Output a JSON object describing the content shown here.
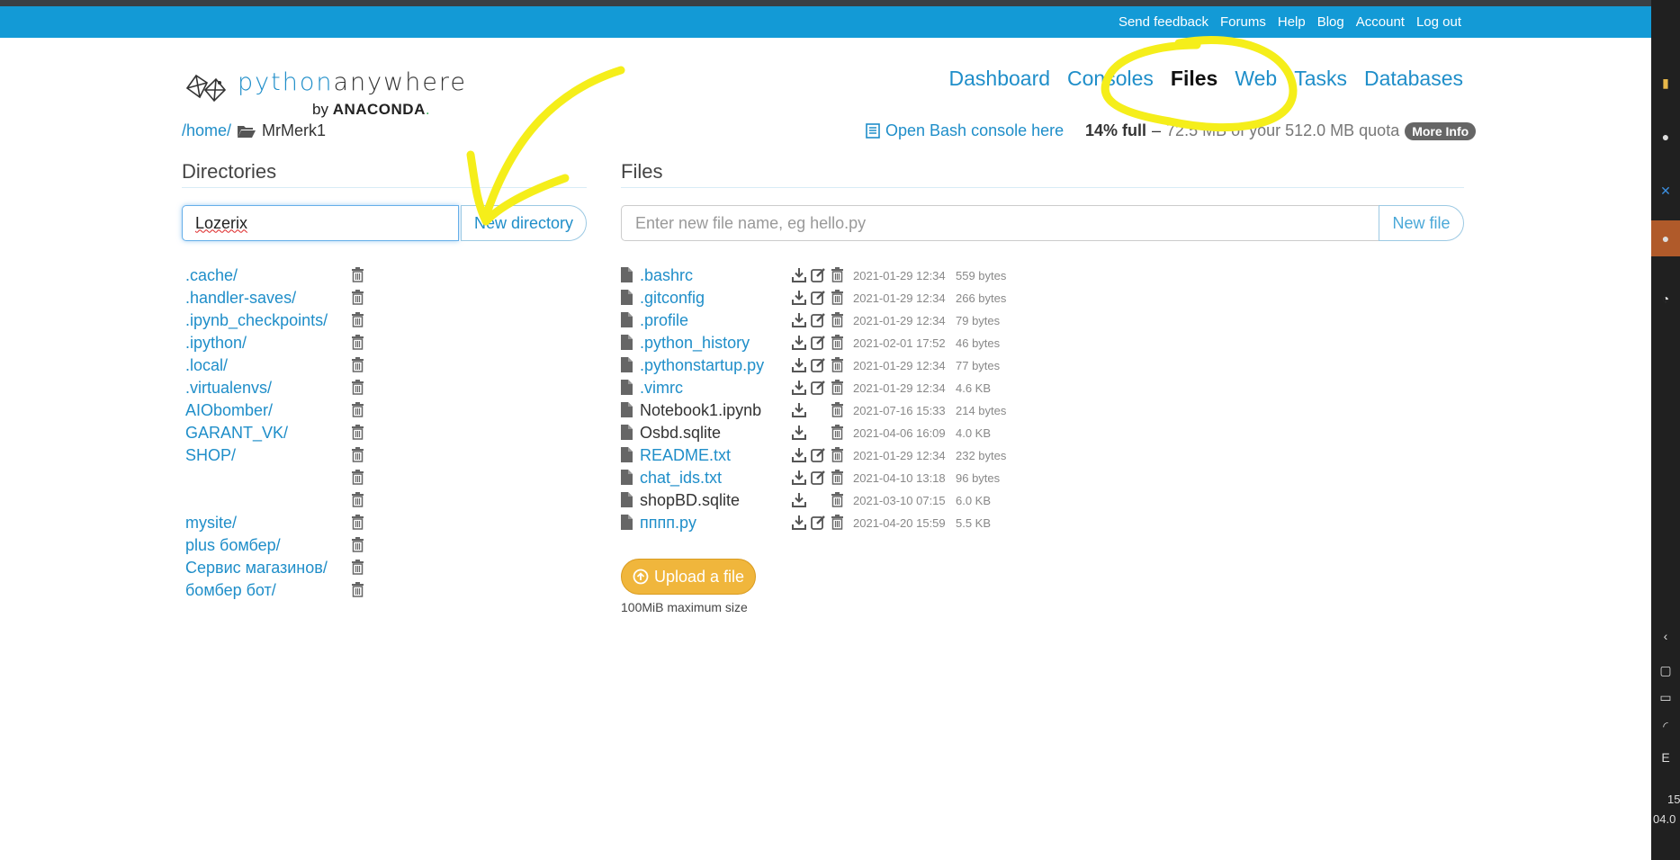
{
  "topnav": {
    "links": [
      "Send feedback",
      "Forums",
      "Help",
      "Blog",
      "Account",
      "Log out"
    ]
  },
  "logo": {
    "word_a": "python",
    "word_b": "anywhere",
    "by": "by",
    "brand": "ANACONDA",
    "brand_dot": "."
  },
  "mainnav": {
    "items": [
      "Dashboard",
      "Consoles",
      "Files",
      "Web",
      "Tasks",
      "Databases"
    ],
    "active": "Files"
  },
  "breadcrumb": {
    "home": "/home/",
    "user": "MrMerk1"
  },
  "actions": {
    "bash": "Open Bash console here",
    "quota_full": "14% full",
    "quota_dash": "–",
    "quota_rest": "72.5 MB of your 512.0 MB quota",
    "more_info": "More Info"
  },
  "directories": {
    "title": "Directories",
    "input_value": "Lozerix",
    "button": "New directory",
    "items": [
      ".cache/",
      ".handler-saves/",
      ".ipynb_checkpoints/",
      ".ipython/",
      ".local/",
      ".virtualenvs/",
      "AIObomber/",
      "GARANT_VK/",
      "SHOP/",
      "",
      "",
      "mysite/",
      "plus бомбер/",
      "Сервис магазинов/",
      "бомбер бот/"
    ]
  },
  "files": {
    "title": "Files",
    "placeholder": "Enter new file name, eg hello.py",
    "button": "New file",
    "items": [
      {
        "name": ".bashrc",
        "editable": true,
        "date": "2021-01-29 12:34",
        "size": "559 bytes"
      },
      {
        "name": ".gitconfig",
        "editable": true,
        "date": "2021-01-29 12:34",
        "size": "266 bytes"
      },
      {
        "name": ".profile",
        "editable": true,
        "date": "2021-01-29 12:34",
        "size": "79 bytes"
      },
      {
        "name": ".python_history",
        "editable": true,
        "date": "2021-02-01 17:52",
        "size": "46 bytes"
      },
      {
        "name": ".pythonstartup.py",
        "editable": true,
        "date": "2021-01-29 12:34",
        "size": "77 bytes"
      },
      {
        "name": ".vimrc",
        "editable": true,
        "date": "2021-01-29 12:34",
        "size": "4.6 KB"
      },
      {
        "name": "Notebook1.ipynb",
        "editable": false,
        "date": "2021-07-16 15:33",
        "size": "214 bytes"
      },
      {
        "name": "Osbd.sqlite",
        "editable": false,
        "date": "2021-04-06 16:09",
        "size": "4.0 KB"
      },
      {
        "name": "README.txt",
        "editable": true,
        "date": "2021-01-29 12:34",
        "size": "232 bytes"
      },
      {
        "name": "chat_ids.txt",
        "editable": true,
        "date": "2021-04-10 13:18",
        "size": "96 bytes"
      },
      {
        "name": "shopBD.sqlite",
        "editable": false,
        "date": "2021-03-10 07:15",
        "size": "6.0 KB"
      },
      {
        "name": "пппп.py",
        "editable": true,
        "date": "2021-04-20 15:59",
        "size": "5.5 KB"
      }
    ],
    "upload": "Upload a file",
    "upload_note": "100MiB maximum size"
  },
  "taskbar": {
    "language": "E",
    "time": "15",
    "date": "04.0"
  },
  "colors": {
    "topnav": "#139ad6",
    "link": "#1f8ec9",
    "upload": "#f0b63c",
    "annotation": "#f5ee1a"
  },
  "icons": [
    "file-icon",
    "download-icon",
    "edit-icon",
    "trash-icon",
    "folder-open-icon",
    "terminal-icon",
    "upload-icon"
  ]
}
